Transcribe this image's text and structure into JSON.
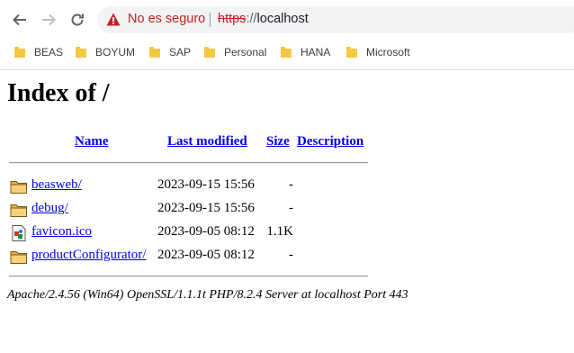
{
  "browser": {
    "nav": {
      "back_icon": "arrow-left-icon",
      "forward_icon": "arrow-right-icon",
      "reload_icon": "reload-icon"
    },
    "omnibox": {
      "warning_icon": "warning-triangle-icon",
      "security_label": "No es seguro",
      "url_scheme": "https",
      "url_separator": "://",
      "url_host": "localhost",
      "security_color": "#c5221f"
    },
    "bookmarks": [
      {
        "label": "BEAS",
        "icon": "folder-icon"
      },
      {
        "label": "BOYUM",
        "icon": "folder-icon"
      },
      {
        "label": "SAP",
        "icon": "folder-icon"
      },
      {
        "label": "Personal",
        "icon": "folder-icon"
      },
      {
        "label": "HANA",
        "icon": "folder-icon"
      },
      {
        "label": "Microsoft",
        "icon": "folder-icon"
      }
    ]
  },
  "page": {
    "title": "Index of /",
    "columns": {
      "name": "Name",
      "last_modified": "Last modified",
      "size": "Size",
      "description": "Description"
    },
    "entries": [
      {
        "name": "beasweb/",
        "modified": "2023-09-15 15:56",
        "size": "-",
        "description": "",
        "icon": "folder-icon"
      },
      {
        "name": "debug/",
        "modified": "2023-09-15 15:56",
        "size": "-",
        "description": "",
        "icon": "folder-icon"
      },
      {
        "name": "favicon.ico",
        "modified": "2023-09-05 08:12",
        "size": "1.1K",
        "description": "",
        "icon": "image-file-icon"
      },
      {
        "name": "productConfigurator/",
        "modified": "2023-09-05 08:12",
        "size": "-",
        "description": "",
        "icon": "folder-icon"
      }
    ],
    "server_signature": "Apache/2.4.56 (Win64) OpenSSL/1.1.1t PHP/8.2.4 Server at localhost Port 443",
    "link_color": "#0000ee"
  }
}
